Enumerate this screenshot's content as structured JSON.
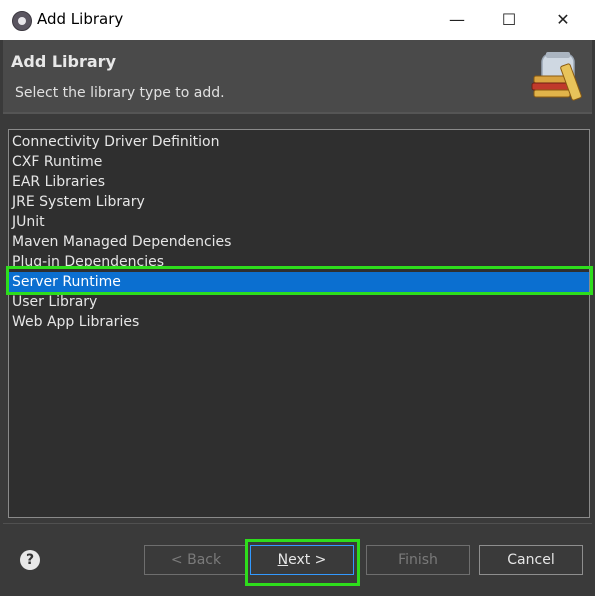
{
  "window": {
    "title": "Add Library"
  },
  "header": {
    "title": "Add Library",
    "description": "Select the library type to add."
  },
  "library_types": [
    "Connectivity Driver Definition",
    "CXF Runtime",
    "EAR Libraries",
    "JRE System Library",
    "JUnit",
    "Maven Managed Dependencies",
    "Plug-in Dependencies",
    "Server Runtime",
    "User Library",
    "Web App Libraries"
  ],
  "selected_item": "Server Runtime",
  "buttons": {
    "back": "< Back",
    "next_mnemonic": "N",
    "next_rest": "ext >",
    "finish": "Finish",
    "cancel": "Cancel"
  },
  "help_glyph": "?",
  "colors": {
    "selection": "#0b6fd0",
    "highlight_box": "#2edd1c",
    "dialog_bg": "#3a3a3a"
  }
}
